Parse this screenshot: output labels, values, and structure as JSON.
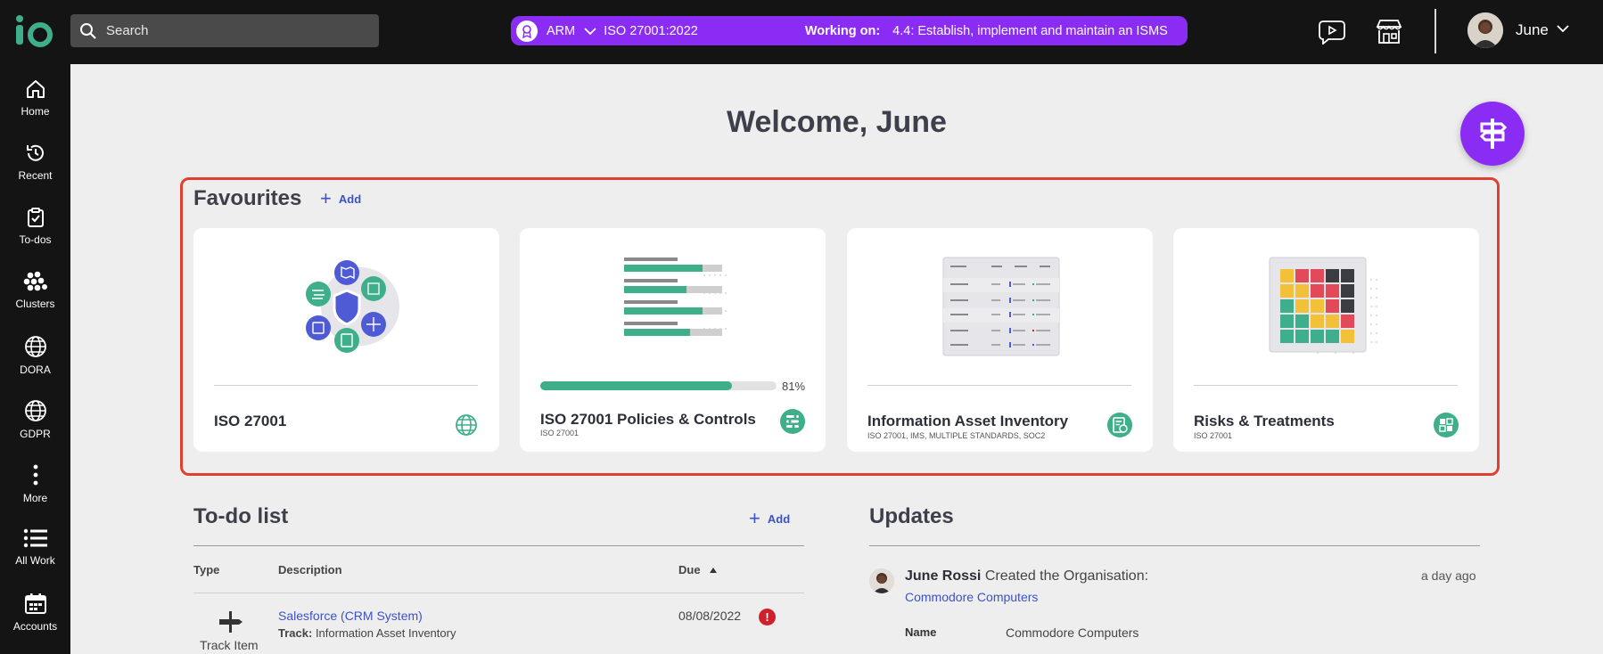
{
  "colors": {
    "accent": "#8b2cf5",
    "topbar": "#141414",
    "link": "#3c52c9",
    "green": "#3fae8a",
    "alert": "#d0202a",
    "highlight": "#e0412f"
  },
  "header": {
    "search_placeholder": "Search",
    "context": {
      "org": "ARM",
      "standard": "ISO 27001:2022",
      "working_label": "Working on:",
      "working_task": "4.4: Establish, implement and maintain an ISMS"
    },
    "user_name": "June"
  },
  "sidebar": {
    "items": [
      {
        "label": "Home",
        "icon": "home-icon"
      },
      {
        "label": "Recent",
        "icon": "history-icon"
      },
      {
        "label": "To-dos",
        "icon": "clipboard-check-icon"
      },
      {
        "label": "Clusters",
        "icon": "clusters-icon"
      },
      {
        "label": "DORA",
        "icon": "globe-icon"
      },
      {
        "label": "GDPR",
        "icon": "globe-icon"
      },
      {
        "label": "More",
        "icon": "more-vertical-icon"
      },
      {
        "label": "All Work",
        "icon": "list-icon"
      },
      {
        "label": "Accounts",
        "icon": "calendar-icon"
      }
    ]
  },
  "main": {
    "welcome": "Welcome, June",
    "favourites": {
      "title": "Favourites",
      "add_label": "Add",
      "cards": [
        {
          "title": "ISO 27001",
          "subtitle": "",
          "icon": "globe-icon"
        },
        {
          "title": "ISO 27001 Policies & Controls",
          "subtitle": "ISO 27001",
          "progress": 0.81,
          "progress_label": "81%",
          "icon": "policies-icon"
        },
        {
          "title": "Information Asset Inventory",
          "subtitle": "ISO 27001, IMS, MULTIPLE STANDARDS, SOC2",
          "icon": "inventory-icon"
        },
        {
          "title": "Risks & Treatments",
          "subtitle": "ISO 27001",
          "icon": "risk-grid-icon"
        }
      ]
    },
    "todo": {
      "title": "To-do list",
      "add_label": "Add",
      "columns": [
        "Type",
        "Description",
        "Due"
      ],
      "rows": [
        {
          "type": "Track Item",
          "description": "Salesforce (CRM System)",
          "track_label": "Track:",
          "track": "Information Asset Inventory",
          "due": "08/08/2022",
          "alert": "!"
        }
      ]
    },
    "updates": {
      "title": "Updates",
      "items": [
        {
          "user": "June Rossi",
          "action": "Created the Organisation:",
          "link": "Commodore Computers",
          "time": "a day ago",
          "field_label": "Name",
          "field_value": "Commodore Computers"
        }
      ]
    }
  }
}
